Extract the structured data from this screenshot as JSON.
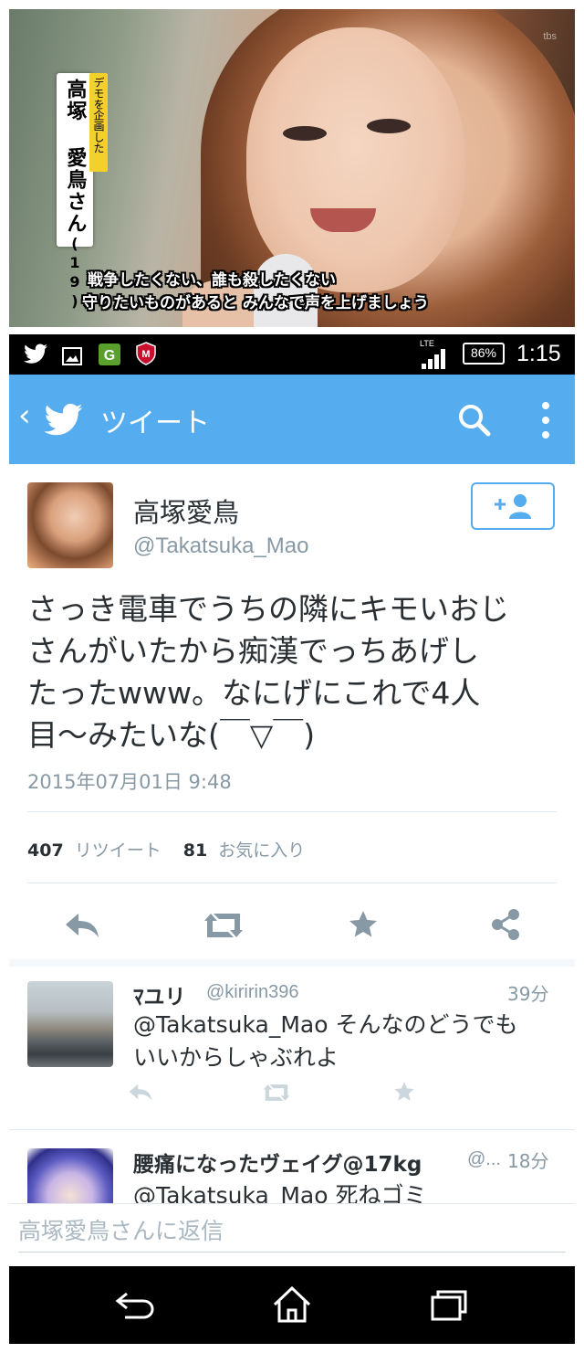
{
  "tv": {
    "channel_logo": "tbs",
    "name_tag": "デモを企画した",
    "name": "高塚 愛鳥さん",
    "age": "(19)",
    "subtitle_line1": "戦争したくない、誰も殺したくない",
    "subtitle_line2": "守りたいものがあると みんなで声を上げましょう"
  },
  "status_bar": {
    "network": "LTE",
    "battery": "86%",
    "time": "1:15"
  },
  "action_bar": {
    "back_glyph": "‹",
    "title": "ツイート",
    "icons": [
      "twitter-bird-icon",
      "search-icon",
      "overflow-menu-icon"
    ]
  },
  "tweet": {
    "display_name": "高塚愛鳥",
    "handle": "@Takatsuka_Mao",
    "text_lines": [
      "さっき電車でうちの隣にキモいおじ",
      "さんがいたから痴漢でっちあげし",
      "たったwww。なにげにこれで4人",
      "目〜みたいな(￣▽￣)"
    ],
    "timestamp": "2015年07月01日 9:48",
    "retweet_count": "407",
    "retweet_label": "リツイート",
    "favorite_count": "81",
    "favorite_label": "お気に入り"
  },
  "replies": [
    {
      "name": "ﾏユリ",
      "handle": "@kiririn396",
      "time": "39分",
      "text_line1": "@Takatsuka_Mao そんなのどうでも",
      "text_line2": "いいからしゃぶれよ"
    },
    {
      "name": "腰痛になったヴェイグ@17kg",
      "handle": "@...",
      "time": "18分",
      "text_line1": "@Takatsuka_Mao 死ねゴミ"
    }
  ],
  "reply_box": {
    "placeholder": "高塚愛鳥さんに返信"
  },
  "colors": {
    "twitter_blue": "#55acee",
    "muted": "#8899a6",
    "text": "#292f33"
  }
}
